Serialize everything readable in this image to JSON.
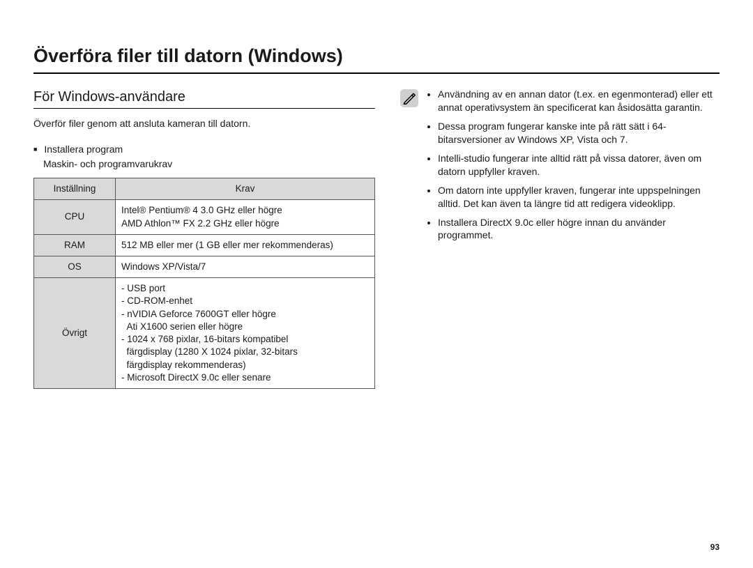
{
  "page": {
    "title": "Överföra filer till datorn (Windows)",
    "number": "93"
  },
  "left": {
    "subhead": "För Windows-användare",
    "intro": "Överför filer genom att ansluta kameran till datorn.",
    "section_bullet": "Installera program",
    "section_sub": "Maskin- och programvarukrav",
    "table": {
      "head_setting": "Inställning",
      "head_req": "Krav",
      "rows": {
        "cpu_label": "CPU",
        "cpu_line1": "Intel® Pentium® 4 3.0 GHz eller högre",
        "cpu_line2": "AMD Athlon™ FX 2.2 GHz eller högre",
        "ram_label": "RAM",
        "ram_val": "512 MB eller mer (1 GB eller mer rekommenderas)",
        "os_label": "OS",
        "os_val": "Windows XP/Vista/7",
        "other_label": "Övrigt",
        "other_items": [
          "- USB port",
          "- CD-ROM-enhet",
          "- nVIDIA Geforce 7600GT eller högre",
          "  Ati X1600 serien eller högre",
          "- 1024 x 768 pixlar, 16-bitars kompatibel",
          "  färgdisplay (1280 X 1024 pixlar, 32-bitars",
          "  färgdisplay rekommenderas)",
          "- Microsoft DirectX 9.0c eller senare"
        ]
      }
    }
  },
  "right": {
    "notes": [
      "Användning av en annan dator (t.ex. en egenmonterad) eller ett annat operativsystem än specificerat kan åsidosätta garantin.",
      "Dessa program fungerar kanske inte på rätt sätt i 64-bitarsversioner av Windows XP, Vista och 7.",
      "Intelli-studio fungerar inte alltid rätt på vissa datorer, även om datorn uppfyller kraven.",
      "Om datorn inte uppfyller kraven, fungerar inte uppspelningen alltid. Det kan även ta längre tid att redigera videoklipp.",
      "Installera DirectX 9.0c eller högre innan du använder programmet."
    ]
  }
}
